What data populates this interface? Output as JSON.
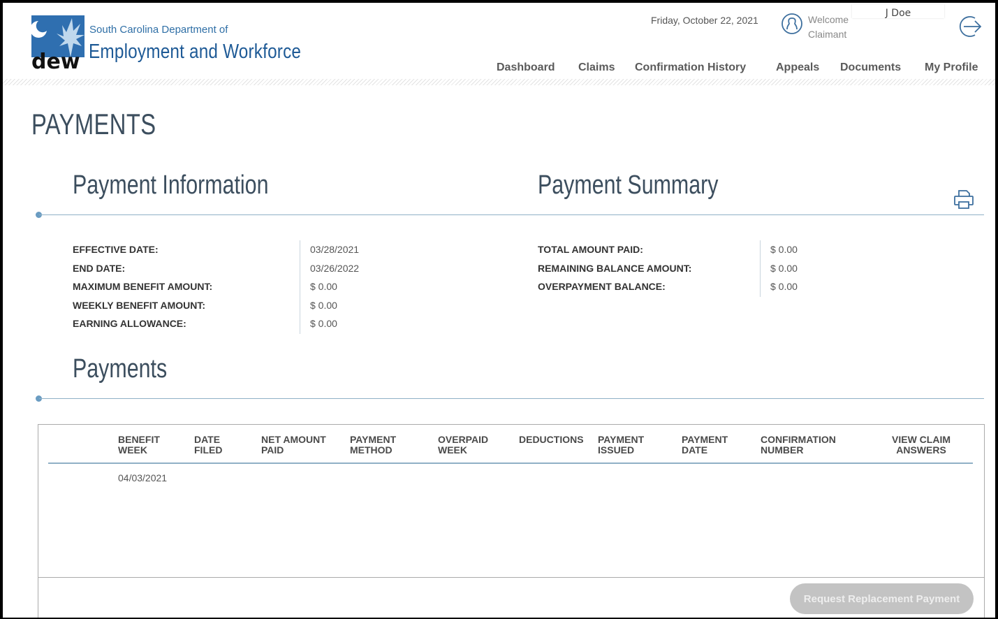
{
  "header": {
    "org_line1": "South Carolina Department of",
    "org_line2": "Employment and Workforce",
    "logo_text": "dew",
    "date": "Friday, October 22, 2021",
    "welcome": "Welcome",
    "role": "Claimant",
    "username": "J Doe"
  },
  "nav": [
    "Dashboard",
    "Claims",
    "Confirmation History",
    "Appeals",
    "Documents",
    "My Profile"
  ],
  "page_title": "PAYMENTS",
  "payment_information": {
    "title": "Payment Information",
    "rows": [
      {
        "label": "EFFECTIVE DATE:",
        "value": "03/28/2021"
      },
      {
        "label": "END DATE:",
        "value": "03/26/2022"
      },
      {
        "label": "MAXIMUM BENEFIT AMOUNT:",
        "value": "$ 0.00"
      },
      {
        "label": "WEEKLY BENEFIT AMOUNT:",
        "value": "$ 0.00"
      },
      {
        "label": "EARNING ALLOWANCE:",
        "value": "$ 0.00"
      }
    ]
  },
  "payment_summary": {
    "title": "Payment Summary",
    "rows": [
      {
        "label": "TOTAL AMOUNT PAID:",
        "value": "$ 0.00"
      },
      {
        "label": "REMAINING BALANCE AMOUNT:",
        "value": "$ 0.00"
      },
      {
        "label": "OVERPAYMENT BALANCE:",
        "value": "$ 0.00"
      }
    ]
  },
  "payments": {
    "title": "Payments",
    "columns": [
      "BENEFIT\nWEEK",
      "DATE\nFILED",
      "NET AMOUNT\nPAID",
      "PAYMENT\nMETHOD",
      "OVERPAID\nWEEK",
      "DEDUCTIONS",
      "PAYMENT\nISSUED",
      "PAYMENT\nDATE",
      "CONFIRMATION\nNUMBER",
      "VIEW CLAIM\nANSWERS"
    ],
    "rows": [
      {
        "benefit_week": "04/03/2021"
      }
    ],
    "button": "Request Replacement Payment"
  },
  "colors": {
    "brand": "#1e5a96",
    "heading": "#3c4e5e",
    "rule": "#8fb0c6",
    "button_disabled": "#c3c3c3"
  },
  "icons": [
    "logo-icon",
    "user-icon",
    "logout-icon",
    "print-icon"
  ]
}
